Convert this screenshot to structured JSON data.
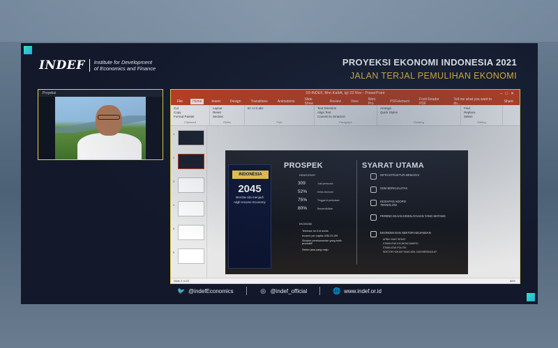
{
  "brand": {
    "logo_word": "INDEF",
    "logo_desc_line1": "Institute for Development",
    "logo_desc_line2": "of Economics and Finance"
  },
  "header": {
    "title": "PROYEKSI EKONOMI INDONESIA 2021",
    "subtitle": "JALAN TERJAL PEMULIHAN EKONOMI"
  },
  "colors": {
    "accent_yellow": "#f3c33a",
    "ppt_red": "#c43e1c",
    "frame_dark": "#13182a",
    "corner_teal": "#2ee6c0"
  },
  "powerpoint": {
    "doc_title": "03-INDEF, Bhn Kalbft, tgl 23 Nov - PowerPoint",
    "tabs": [
      "File",
      "Home",
      "Insert",
      "Design",
      "Transitions",
      "Animations",
      "Slide Show",
      "Review",
      "View",
      "Nitro Pro",
      "PDFelement",
      "Foxit Reader PDF"
    ],
    "tell_me": "Tell me what you want to do...",
    "share": "Share",
    "ribbon_groups": [
      {
        "label": "Clipboard",
        "items": [
          "Cut",
          "Copy",
          "Format Painter"
        ]
      },
      {
        "label": "Slides",
        "items": [
          "Layout",
          "Reset",
          "Section"
        ]
      },
      {
        "label": "Font",
        "items": [
          "B I U S abc"
        ]
      },
      {
        "label": "Paragraph",
        "items": [
          "Text Direction",
          "Align Text",
          "Convert to SmartArt"
        ]
      },
      {
        "label": "Drawing",
        "items": [
          "Arrange",
          "Quick Styles"
        ]
      },
      {
        "label": "Editing",
        "items": [
          "Find",
          "Replace",
          "Select"
        ]
      }
    ],
    "status_left": "Slide 2 of 22",
    "status_zoom": "86%"
  },
  "slide": {
    "indonesia_label": "INDONESIA",
    "year": "2045",
    "vision_line1": "Bercita-cita menjadi",
    "vision_line2": "High-Income Economy",
    "prospek_title": "PROSPEK",
    "syarat_title": "SYARAT UTAMA",
    "demografi_label": "DEMOGRAFI",
    "ekonomi_label": "EKONOMI",
    "stats": [
      {
        "value": "309",
        "label": "Juta penduduk"
      },
      {
        "value": "52%",
        "label": "Kelas ekonomi"
      },
      {
        "value": "75%",
        "label": "Tinggal di perkotaan"
      },
      {
        "value": "80%",
        "label": "Berpendidikan"
      }
    ],
    "econ_bullets": [
      "Terbesar ke-5 di dunia",
      "Income per capita US$ 23.199",
      "Struktur perekonomian yang lebih produktif",
      "Sektor jasa yang maju"
    ],
    "requirements": [
      {
        "label": "INFRASTRUKTUR MEMADAI"
      },
      {
        "label": "SDM BERKUALITAS"
      },
      {
        "label": "KESIAPAN ADOPSI TEKNOLOGI"
      },
      {
        "label": "PERENCANAAN KEWILAYAHAN YANG MATANG"
      },
      {
        "label": "EKONOMI DAN SEKTOR KEUANGAN"
      }
    ],
    "req_bullets": [
      "APBN YANG SEHAT",
      "STABILITAS EKONOMI MAKRO",
      "STABILITAS POLITIK",
      "SEKTOR HUKUM YANG ADIL DAN BERDAULAT"
    ]
  },
  "webcam": {
    "label": "Proyeksi"
  },
  "social": {
    "twitter": "@indefEconomics",
    "instagram": "@indef_official",
    "website": "www.indef.or.id"
  }
}
